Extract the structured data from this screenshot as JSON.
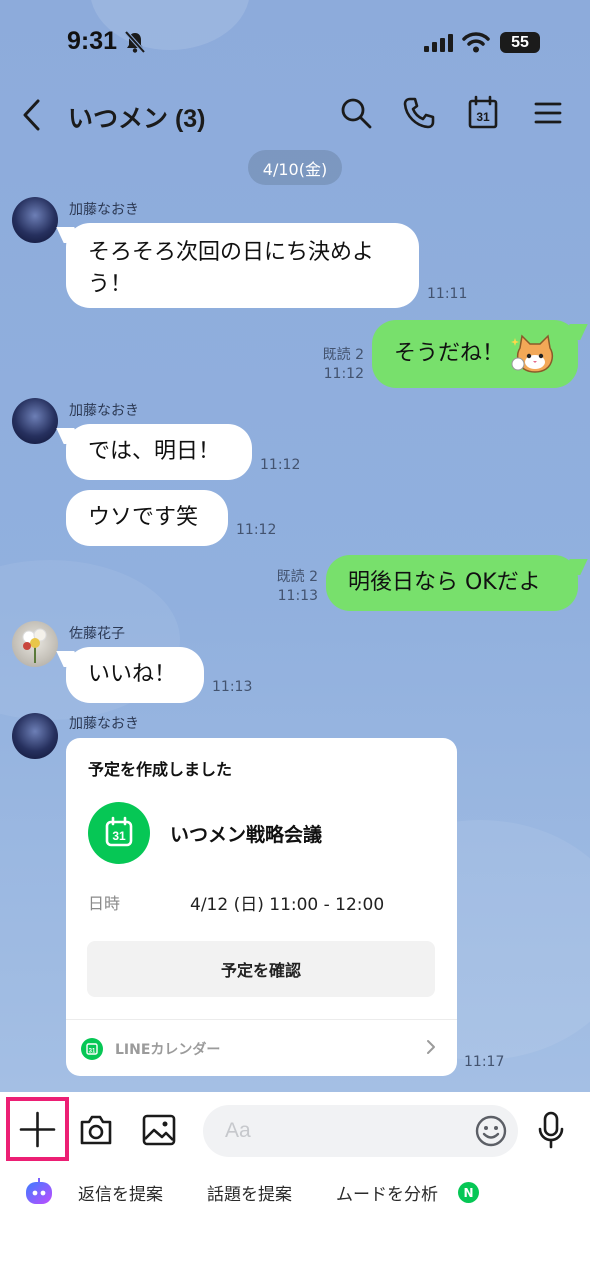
{
  "status_bar": {
    "time": "9:31",
    "battery": "55"
  },
  "header": {
    "title": "いつメン (3)",
    "calendar_day": "31"
  },
  "date_separator": "4/10(金)",
  "messages": [
    {
      "sender": "加藤なおき",
      "lines": [
        "そろそろ次回の日にち決めよ",
        "う！"
      ],
      "time": "11:11"
    },
    {
      "text": "そうだね！",
      "read": "既読 2",
      "time": "11:12"
    },
    {
      "sender": "加藤なおき",
      "text": "では、明日！",
      "time": "11:12"
    },
    {
      "text": "ウソです笑",
      "time": "11:12"
    },
    {
      "text": "明後日なら OKだよ",
      "read": "既読 2",
      "time": "11:13"
    },
    {
      "sender": "佐藤花子",
      "text": "いいね！",
      "time": "11:13"
    },
    {
      "sender": "加藤なおき",
      "time": "11:17"
    }
  ],
  "event_card": {
    "title": "予定を作成しました",
    "icon_day": "31",
    "event_name": "いつメン戦略会議",
    "datetime_label": "日時",
    "datetime_value": "4/12 (日) 11:00 - 12:00",
    "confirm_label": "予定を確認",
    "footer_icon_day": "31",
    "footer_label": "LINEカレンダー"
  },
  "composer": {
    "placeholder": "Aa"
  },
  "suggestions": [
    {
      "label": "返信を提案"
    },
    {
      "label": "話題を提案"
    },
    {
      "label": "ムードを分析",
      "badge": "N"
    }
  ],
  "colors": {
    "chat_background": "#8dabdb",
    "outgoing_bubble": "#78e06c",
    "line_green": "#06c755",
    "highlight_box": "#ec1f74"
  }
}
